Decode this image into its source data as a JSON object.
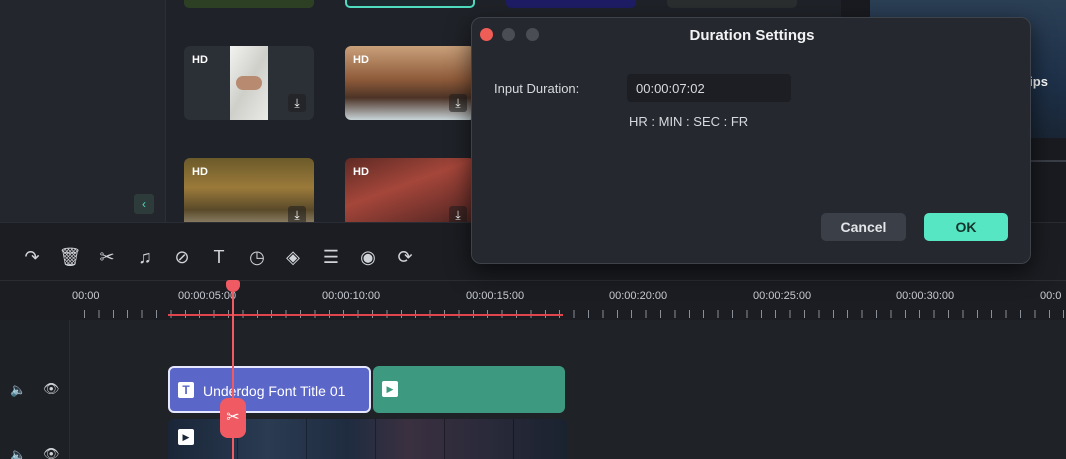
{
  "library": {
    "thumbs": [
      {
        "badge": "HD",
        "download": "⤓"
      },
      {
        "badge": "HD",
        "download": "⤓"
      },
      {
        "badge": "HD",
        "download": "⤓"
      },
      {
        "badge": "HD",
        "download": "⤓"
      }
    ],
    "collapse_icon": "‹",
    "preview_text": "m ips"
  },
  "toolbar": {
    "icons": [
      "redo-icon",
      "delete-icon",
      "cut-icon",
      "audio-icon",
      "tag-icon",
      "text-icon",
      "timer-icon",
      "color-icon",
      "adjust-icon",
      "audio-stretch-icon",
      "speed-icon"
    ],
    "glyphs": [
      "↷",
      "🗑",
      "✂",
      "♫",
      "⊘",
      "T",
      "◷",
      "◈",
      "☰",
      "◉",
      "⟳"
    ]
  },
  "timeline": {
    "ruler_labels": [
      "00:00",
      "00:00:05:00",
      "00:00:10:00",
      "00:00:15:00",
      "00:00:20:00",
      "00:00:25:00",
      "00:00:30:00",
      "00:0"
    ],
    "title_clip": {
      "icon": "T",
      "label": "Underdog Font Title 01"
    },
    "green_clip": {
      "icon": "▶"
    },
    "video_clip": {
      "icon": "▶"
    },
    "track_icons": {
      "speaker": "🔈",
      "eye": "👁"
    },
    "scissor": "✂"
  },
  "dialog": {
    "title": "Duration Settings",
    "input_label": "Input Duration:",
    "input_value": "00:00:07:02",
    "format_hint": "HR : MIN : SEC : FR",
    "cancel_label": "Cancel",
    "ok_label": "OK",
    "colors": {
      "close": "#ee5e56",
      "ok": "#57e6c4"
    }
  }
}
